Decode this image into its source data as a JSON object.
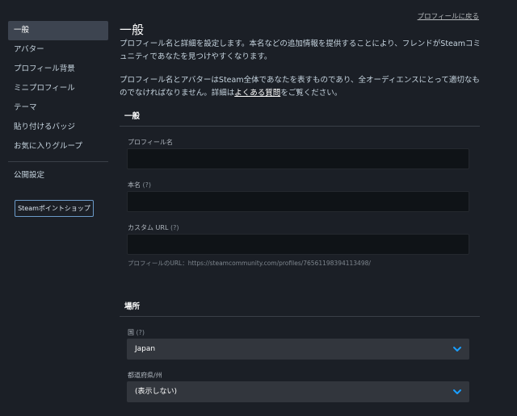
{
  "sidebar": {
    "items": [
      {
        "label": "一般"
      },
      {
        "label": "アバター"
      },
      {
        "label": "プロフィール背景"
      },
      {
        "label": "ミニプロフィール"
      },
      {
        "label": "テーマ"
      },
      {
        "label": "貼り付けるバッジ"
      },
      {
        "label": "お気に入りグループ"
      }
    ],
    "privacy_label": "公開設定",
    "shop_button": "Steamポイントショップ"
  },
  "header": {
    "back_link": "プロフィールに戻る",
    "title": "一般"
  },
  "intro": {
    "para1": "プロフィール名と詳細を設定します。本名などの追加情報を提供することにより、フレンドがSteamコミュニティであなたを見つけやすくなります。",
    "para2_before": "プロフィール名とアバターはSteam全体であなたを表すものであり、全オーディエンスにとって適切なものでなければなりません。詳細は",
    "para2_link": "よくある質問",
    "para2_after": "をご覧ください。"
  },
  "general_section": {
    "title": "一般",
    "profile_name": {
      "label": "プロフィール名",
      "value": ""
    },
    "real_name": {
      "label": "本名",
      "help": "(?)",
      "value": ""
    },
    "custom_url": {
      "label": "カスタム URL",
      "help": "(?)",
      "value": ""
    },
    "url_hint": "プロフィールのURL：https://steamcommunity.com/profiles/76561198394113498/"
  },
  "location_section": {
    "title": "場所",
    "country": {
      "label": "国",
      "help": "(?)",
      "value": "Japan"
    },
    "prefecture": {
      "label": "都道府県/州",
      "value": "(表示しない)"
    }
  },
  "colors": {
    "background": "#1b1f26",
    "active_nav": "#3d4450",
    "accent_blue": "#1a9fff",
    "input_bg": "#0f1317",
    "select_bg": "#32363d"
  }
}
